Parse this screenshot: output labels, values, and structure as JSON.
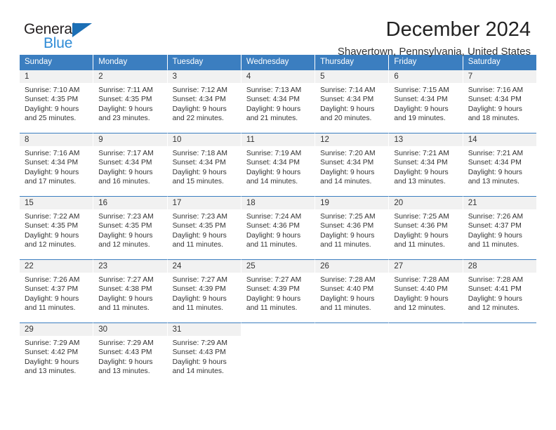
{
  "brand": {
    "name_top": "General",
    "name_bottom": "Blue",
    "logo_icon": "triangle-flag-icon",
    "accent": "#3b7ec0",
    "blue_text": "#2e8bd6"
  },
  "header": {
    "title": "December 2024",
    "location": "Shavertown, Pennsylvania, United States"
  },
  "calendar": {
    "weekday_headers": [
      "Sunday",
      "Monday",
      "Tuesday",
      "Wednesday",
      "Thursday",
      "Friday",
      "Saturday"
    ],
    "weeks": [
      [
        {
          "day": "1",
          "sunrise": "Sunrise: 7:10 AM",
          "sunset": "Sunset: 4:35 PM",
          "daylight1": "Daylight: 9 hours",
          "daylight2": "and 25 minutes."
        },
        {
          "day": "2",
          "sunrise": "Sunrise: 7:11 AM",
          "sunset": "Sunset: 4:35 PM",
          "daylight1": "Daylight: 9 hours",
          "daylight2": "and 23 minutes."
        },
        {
          "day": "3",
          "sunrise": "Sunrise: 7:12 AM",
          "sunset": "Sunset: 4:34 PM",
          "daylight1": "Daylight: 9 hours",
          "daylight2": "and 22 minutes."
        },
        {
          "day": "4",
          "sunrise": "Sunrise: 7:13 AM",
          "sunset": "Sunset: 4:34 PM",
          "daylight1": "Daylight: 9 hours",
          "daylight2": "and 21 minutes."
        },
        {
          "day": "5",
          "sunrise": "Sunrise: 7:14 AM",
          "sunset": "Sunset: 4:34 PM",
          "daylight1": "Daylight: 9 hours",
          "daylight2": "and 20 minutes."
        },
        {
          "day": "6",
          "sunrise": "Sunrise: 7:15 AM",
          "sunset": "Sunset: 4:34 PM",
          "daylight1": "Daylight: 9 hours",
          "daylight2": "and 19 minutes."
        },
        {
          "day": "7",
          "sunrise": "Sunrise: 7:16 AM",
          "sunset": "Sunset: 4:34 PM",
          "daylight1": "Daylight: 9 hours",
          "daylight2": "and 18 minutes."
        }
      ],
      [
        {
          "day": "8",
          "sunrise": "Sunrise: 7:16 AM",
          "sunset": "Sunset: 4:34 PM",
          "daylight1": "Daylight: 9 hours",
          "daylight2": "and 17 minutes."
        },
        {
          "day": "9",
          "sunrise": "Sunrise: 7:17 AM",
          "sunset": "Sunset: 4:34 PM",
          "daylight1": "Daylight: 9 hours",
          "daylight2": "and 16 minutes."
        },
        {
          "day": "10",
          "sunrise": "Sunrise: 7:18 AM",
          "sunset": "Sunset: 4:34 PM",
          "daylight1": "Daylight: 9 hours",
          "daylight2": "and 15 minutes."
        },
        {
          "day": "11",
          "sunrise": "Sunrise: 7:19 AM",
          "sunset": "Sunset: 4:34 PM",
          "daylight1": "Daylight: 9 hours",
          "daylight2": "and 14 minutes."
        },
        {
          "day": "12",
          "sunrise": "Sunrise: 7:20 AM",
          "sunset": "Sunset: 4:34 PM",
          "daylight1": "Daylight: 9 hours",
          "daylight2": "and 14 minutes."
        },
        {
          "day": "13",
          "sunrise": "Sunrise: 7:21 AM",
          "sunset": "Sunset: 4:34 PM",
          "daylight1": "Daylight: 9 hours",
          "daylight2": "and 13 minutes."
        },
        {
          "day": "14",
          "sunrise": "Sunrise: 7:21 AM",
          "sunset": "Sunset: 4:34 PM",
          "daylight1": "Daylight: 9 hours",
          "daylight2": "and 13 minutes."
        }
      ],
      [
        {
          "day": "15",
          "sunrise": "Sunrise: 7:22 AM",
          "sunset": "Sunset: 4:35 PM",
          "daylight1": "Daylight: 9 hours",
          "daylight2": "and 12 minutes."
        },
        {
          "day": "16",
          "sunrise": "Sunrise: 7:23 AM",
          "sunset": "Sunset: 4:35 PM",
          "daylight1": "Daylight: 9 hours",
          "daylight2": "and 12 minutes."
        },
        {
          "day": "17",
          "sunrise": "Sunrise: 7:23 AM",
          "sunset": "Sunset: 4:35 PM",
          "daylight1": "Daylight: 9 hours",
          "daylight2": "and 11 minutes."
        },
        {
          "day": "18",
          "sunrise": "Sunrise: 7:24 AM",
          "sunset": "Sunset: 4:36 PM",
          "daylight1": "Daylight: 9 hours",
          "daylight2": "and 11 minutes."
        },
        {
          "day": "19",
          "sunrise": "Sunrise: 7:25 AM",
          "sunset": "Sunset: 4:36 PM",
          "daylight1": "Daylight: 9 hours",
          "daylight2": "and 11 minutes."
        },
        {
          "day": "20",
          "sunrise": "Sunrise: 7:25 AM",
          "sunset": "Sunset: 4:36 PM",
          "daylight1": "Daylight: 9 hours",
          "daylight2": "and 11 minutes."
        },
        {
          "day": "21",
          "sunrise": "Sunrise: 7:26 AM",
          "sunset": "Sunset: 4:37 PM",
          "daylight1": "Daylight: 9 hours",
          "daylight2": "and 11 minutes."
        }
      ],
      [
        {
          "day": "22",
          "sunrise": "Sunrise: 7:26 AM",
          "sunset": "Sunset: 4:37 PM",
          "daylight1": "Daylight: 9 hours",
          "daylight2": "and 11 minutes."
        },
        {
          "day": "23",
          "sunrise": "Sunrise: 7:27 AM",
          "sunset": "Sunset: 4:38 PM",
          "daylight1": "Daylight: 9 hours",
          "daylight2": "and 11 minutes."
        },
        {
          "day": "24",
          "sunrise": "Sunrise: 7:27 AM",
          "sunset": "Sunset: 4:39 PM",
          "daylight1": "Daylight: 9 hours",
          "daylight2": "and 11 minutes."
        },
        {
          "day": "25",
          "sunrise": "Sunrise: 7:27 AM",
          "sunset": "Sunset: 4:39 PM",
          "daylight1": "Daylight: 9 hours",
          "daylight2": "and 11 minutes."
        },
        {
          "day": "26",
          "sunrise": "Sunrise: 7:28 AM",
          "sunset": "Sunset: 4:40 PM",
          "daylight1": "Daylight: 9 hours",
          "daylight2": "and 11 minutes."
        },
        {
          "day": "27",
          "sunrise": "Sunrise: 7:28 AM",
          "sunset": "Sunset: 4:40 PM",
          "daylight1": "Daylight: 9 hours",
          "daylight2": "and 12 minutes."
        },
        {
          "day": "28",
          "sunrise": "Sunrise: 7:28 AM",
          "sunset": "Sunset: 4:41 PM",
          "daylight1": "Daylight: 9 hours",
          "daylight2": "and 12 minutes."
        }
      ],
      [
        {
          "day": "29",
          "sunrise": "Sunrise: 7:29 AM",
          "sunset": "Sunset: 4:42 PM",
          "daylight1": "Daylight: 9 hours",
          "daylight2": "and 13 minutes."
        },
        {
          "day": "30",
          "sunrise": "Sunrise: 7:29 AM",
          "sunset": "Sunset: 4:43 PM",
          "daylight1": "Daylight: 9 hours",
          "daylight2": "and 13 minutes."
        },
        {
          "day": "31",
          "sunrise": "Sunrise: 7:29 AM",
          "sunset": "Sunset: 4:43 PM",
          "daylight1": "Daylight: 9 hours",
          "daylight2": "and 14 minutes."
        },
        {
          "day": "",
          "sunrise": "",
          "sunset": "",
          "daylight1": "",
          "daylight2": ""
        },
        {
          "day": "",
          "sunrise": "",
          "sunset": "",
          "daylight1": "",
          "daylight2": ""
        },
        {
          "day": "",
          "sunrise": "",
          "sunset": "",
          "daylight1": "",
          "daylight2": ""
        },
        {
          "day": "",
          "sunrise": "",
          "sunset": "",
          "daylight1": "",
          "daylight2": ""
        }
      ]
    ]
  }
}
